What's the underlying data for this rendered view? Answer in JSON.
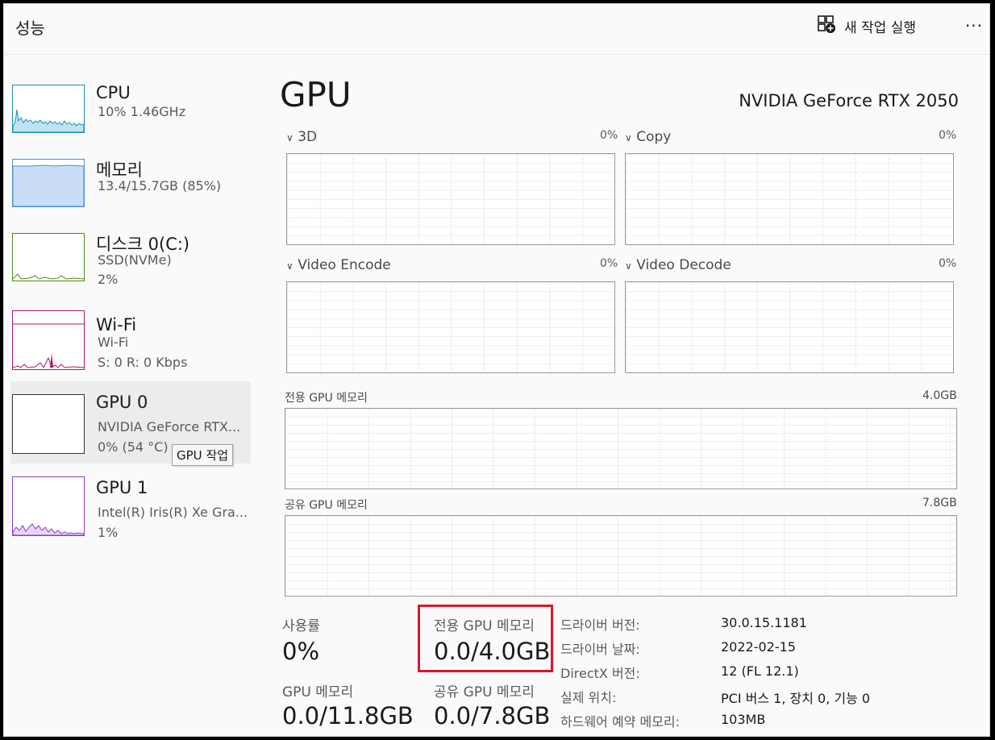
{
  "header": {
    "title": "성능",
    "new_task_label": "새 작업 실행",
    "more_label": "···"
  },
  "sidebar": {
    "items": [
      {
        "title": "CPU",
        "sub1": "10%  1.46GHz",
        "sub2": ""
      },
      {
        "title": "메모리",
        "sub1": "13.4/15.7GB (85%)",
        "sub2": ""
      },
      {
        "title": "디스크 0(C:)",
        "sub1": "SSD(NVMe)",
        "sub2": "2%"
      },
      {
        "title": "Wi-Fi",
        "sub1": "Wi-Fi",
        "sub2": "S: 0  R: 0 Kbps"
      },
      {
        "title": "GPU 0",
        "sub1": "NVIDIA GeForce RTX...",
        "sub2": "0%  (54 °C)"
      },
      {
        "title": "GPU 1",
        "sub1": "Intel(R) Iris(R) Xe Gra...",
        "sub2": "1%"
      }
    ],
    "tooltip": "GPU 작업"
  },
  "main": {
    "heading": "GPU",
    "model": "NVIDIA GeForce RTX 2050",
    "engines": [
      {
        "label": "3D",
        "pct": "0%"
      },
      {
        "label": "Copy",
        "pct": "0%"
      },
      {
        "label": "Video Encode",
        "pct": "0%"
      },
      {
        "label": "Video Decode",
        "pct": "0%"
      }
    ],
    "dedicated_graph": {
      "label": "전용 GPU 메모리",
      "max": "4.0GB"
    },
    "shared_graph": {
      "label": "공유 GPU 메모리",
      "max": "7.8GB"
    }
  },
  "stats": {
    "usage_label": "사용률",
    "usage_value": "0%",
    "dedicated_label": "전용 GPU 메모리",
    "dedicated_value": "0.0/4.0GB",
    "gpu_mem_label": "GPU 메모리",
    "gpu_mem_value": "0.0/11.8GB",
    "shared_label": "공유 GPU 메모리",
    "shared_value": "0.0/7.8GB"
  },
  "info": [
    {
      "label": "드라이버 버전:",
      "value": "30.0.15.1181"
    },
    {
      "label": "드라이버 날짜:",
      "value": "2022-02-15"
    },
    {
      "label": "DirectX 버전:",
      "value": "12 (FL 12.1)"
    },
    {
      "label": "실제 위치:",
      "value": "PCI 버스 1, 장치 0, 기능 0"
    },
    {
      "label": "하드웨어 예약 메모리:",
      "value": "103MB"
    }
  ],
  "colors": {
    "cpu": "#1a8fb8",
    "memory": "#4c8fd6",
    "disk": "#4d8a1f",
    "wifi": "#a8186a",
    "gpu1": "#8a3cc8",
    "highlight": "#d8192a"
  }
}
